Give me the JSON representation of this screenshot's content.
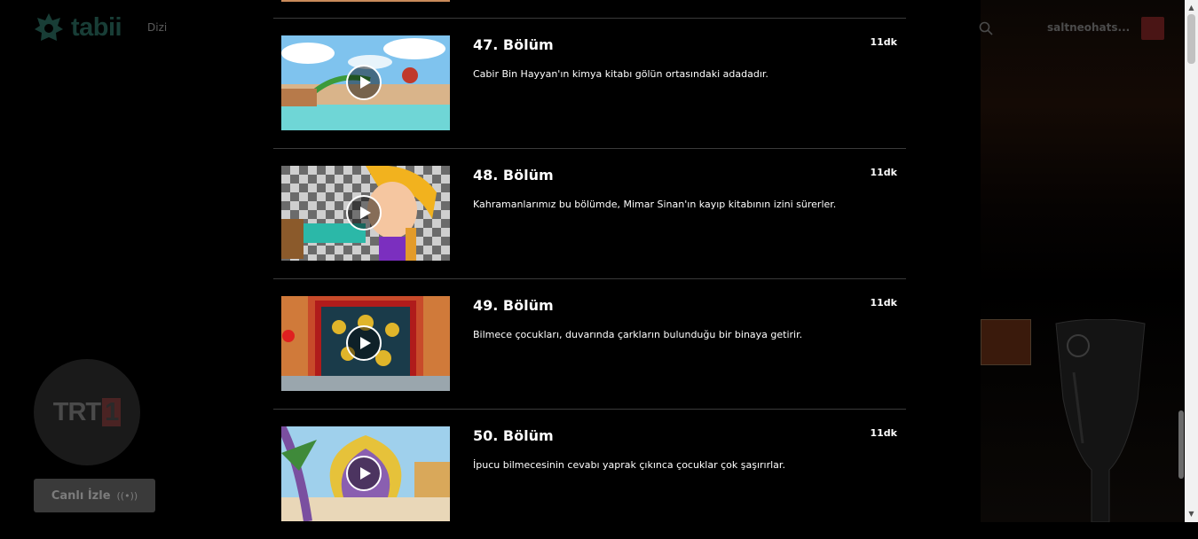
{
  "app": {
    "logo_text": "tabii",
    "nav_item": "Dizi",
    "username": "saltneohats...",
    "brand_color": "#2c6f63"
  },
  "channel": {
    "logo_text": "TRT",
    "logo_number": "1",
    "live_button_label": "Canlı İzle",
    "live_icon": "((•))"
  },
  "episodes": [
    {
      "title": "47. Bölüm",
      "duration": "11dk",
      "description": "Cabir Bin Hayyan'ın kimya kitabı gölün ortasındaki adadadır.",
      "thumb_scene": "lake-sky"
    },
    {
      "title": "48. Bölüm",
      "duration": "11dk",
      "description": "Kahramanlarımız bu bölümde, Mimar Sinan'ın kayıp kitabının izini sürerler.",
      "thumb_scene": "checker-girl"
    },
    {
      "title": "49. Bölüm",
      "duration": "11dk",
      "description": "Bilmece çocukları, duvarında çarkların bulunduğu bir binaya getirir.",
      "thumb_scene": "gear-wall"
    },
    {
      "title": "50. Bölüm",
      "duration": "11dk",
      "description": "İpucu bilmecesinin cevabı yaprak çıkınca çocuklar çok şaşırırlar.",
      "thumb_scene": "leaf-plant"
    }
  ]
}
